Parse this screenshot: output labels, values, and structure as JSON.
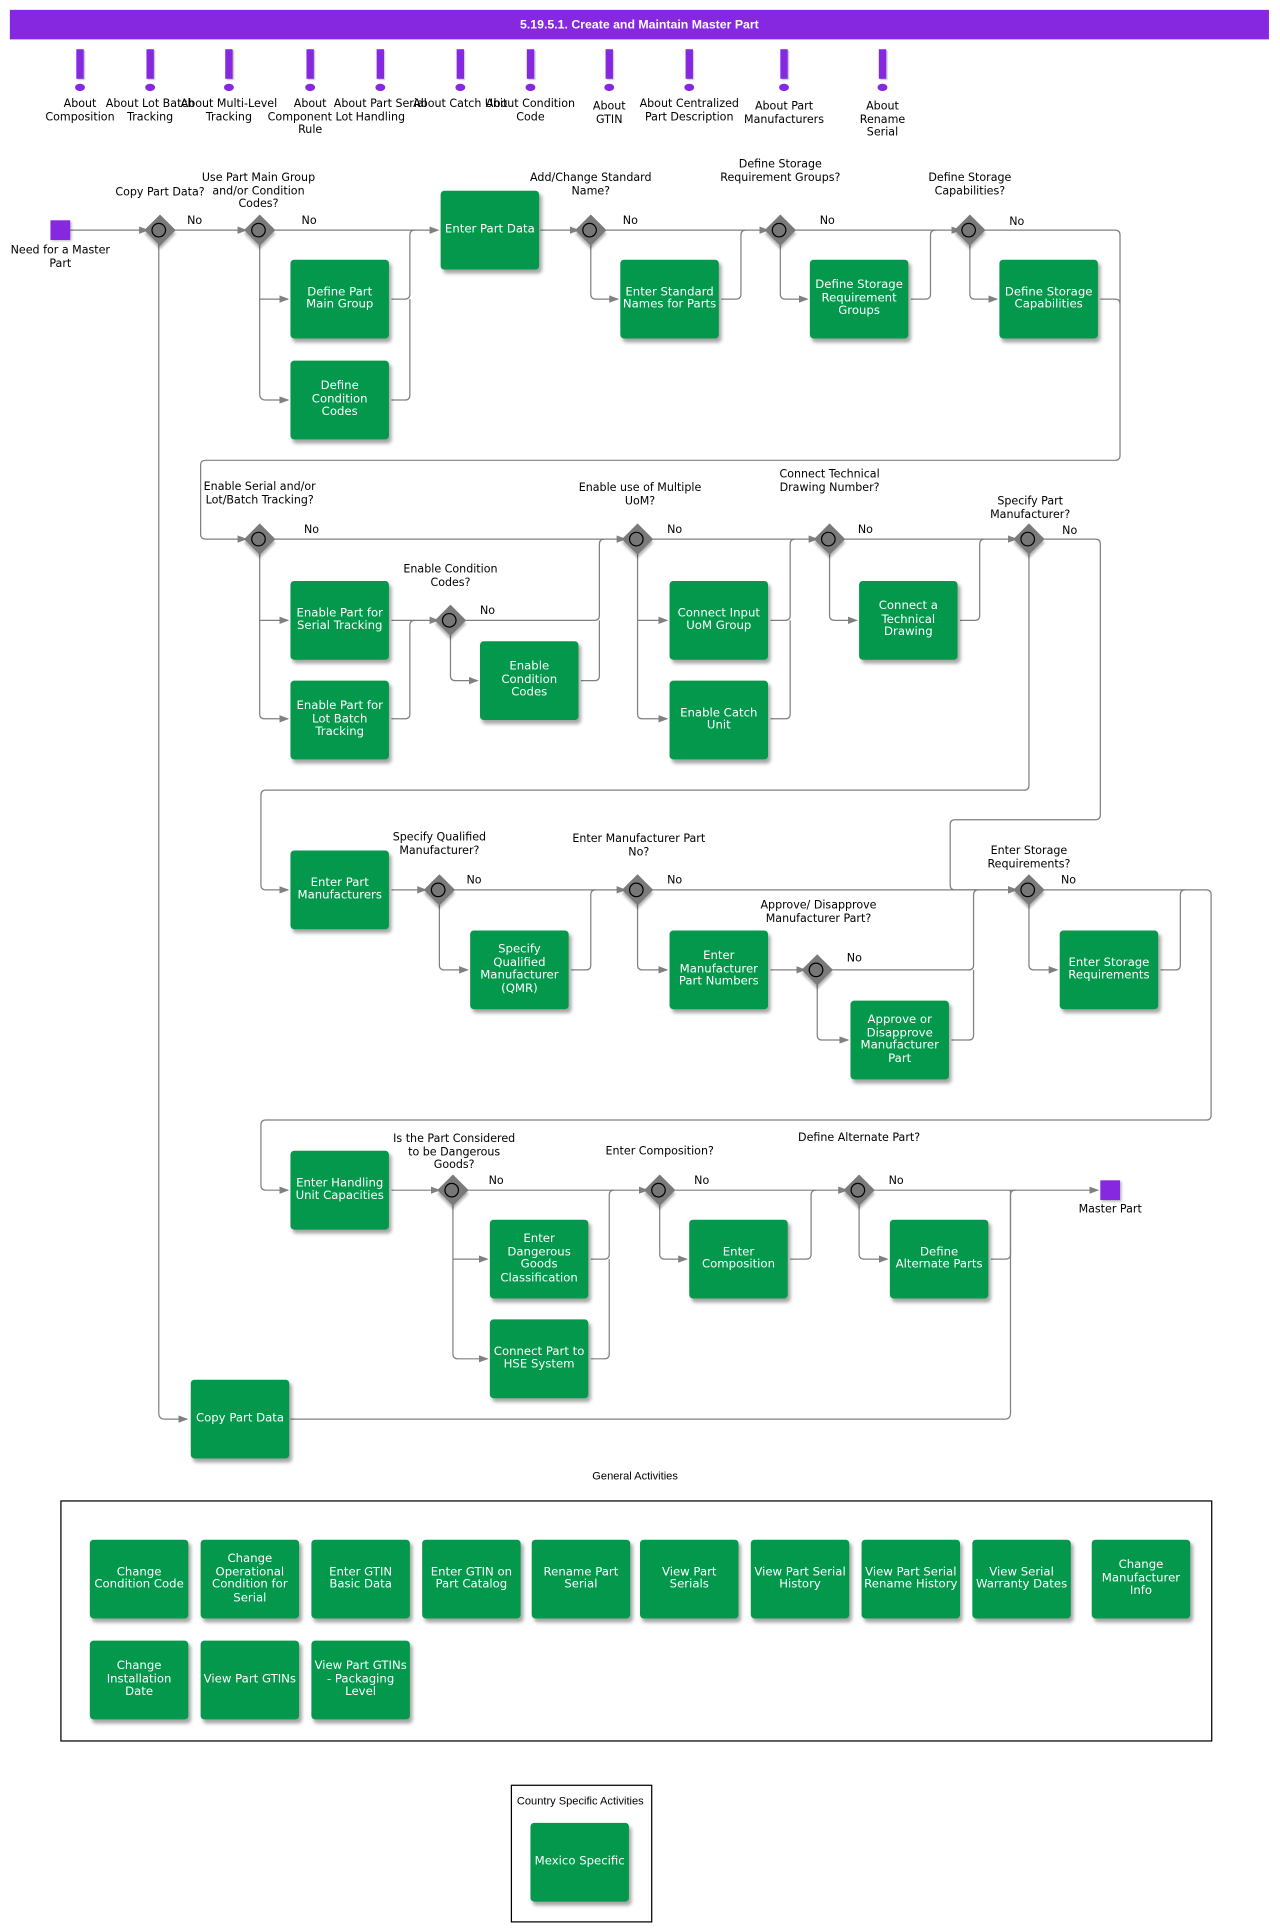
{
  "title": "5.19.5.1. Create and Maintain Master Part",
  "notes": [
    "About Composition",
    "About Lot Batch Tracking",
    "About Multi-Level Tracking",
    "About Component Lot Rule",
    "About Part Serial Handling",
    "About Catch Unit",
    "About Condition Code",
    "About GTIN",
    "About Centralized Part Description",
    "About Part Manufacturers",
    "About Rename Serial"
  ],
  "events": {
    "start": "Need for a Master Part",
    "end": "Master Part"
  },
  "no_label": "No",
  "gateways": {
    "copy_part_data": "Copy Part Data?",
    "use_main_group": "Use Part Main Group and/or Condition Codes?",
    "standard_name": "Add/Change Standard Name?",
    "storage_req_groups": "Define Storage Requirement Groups?",
    "storage_capabilities": "Define Storage Capabilities?",
    "serial_lot_tracking": "Enable Serial and/or Lot/Batch Tracking?",
    "enable_condition_codes": "Enable Condition Codes?",
    "multiple_uom": "Enable use of Multiple UoM?",
    "technical_drawing": "Connect Technical Drawing Number?",
    "specify_manufacturer": "Specify Part Manufacturer?",
    "qualified_manufacturer": "Specify Qualified Manufacturer?",
    "manufacturer_part_no": "Enter Manufacturer Part No?",
    "approve_manufacturer_part": "Approve/ Disapprove Manufacturer Part?",
    "storage_requirements": "Enter Storage Requirements?",
    "dangerous_goods": "Is the Part Considered to be Dangerous Goods?",
    "composition": "Enter Composition?",
    "alternate_part": "Define Alternate Part?"
  },
  "tasks": {
    "enter_part_data": "Enter Part Data",
    "define_main_group": "Define Part Main Group",
    "define_condition_codes": "Define Condition Codes",
    "enter_standard_names": "Enter Standard Names for Parts",
    "define_storage_req_groups": "Define Storage Requirement Groups",
    "define_storage_capabilities": "Define Storage Capabilities",
    "enable_serial_tracking": "Enable Part for Serial Tracking",
    "enable_lot_batch": "Enable Part for Lot Batch Tracking",
    "enable_condition_codes": "Enable Condition Codes",
    "connect_uom_group": "Connect Input UoM Group",
    "enable_catch_unit": "Enable Catch Unit",
    "connect_technical_drawing": "Connect a Technical Drawing",
    "enter_part_manufacturers": "Enter Part Manufacturers",
    "specify_qmr": "Specify Qualified Manufacturer (QMR)",
    "enter_manufacturer_part_numbers": "Enter Manufacturer Part Numbers",
    "approve_manufacturer_part": "Approve or Disapprove Manufacturer Part",
    "enter_storage_requirements": "Enter Storage Requirements",
    "enter_handling_unit_capacities": "Enter Handling Unit Capacities",
    "enter_dangerous_goods": "Enter Dangerous Goods Classification",
    "connect_hse": "Connect Part to HSE System",
    "enter_composition": "Enter Composition",
    "define_alternate_parts": "Define Alternate Parts",
    "copy_part_data": "Copy Part Data"
  },
  "general_activities": {
    "title": "General Activities",
    "items": [
      "Change Condition Code",
      "Change Operational Condition for Serial",
      "Enter GTIN Basic Data",
      "Enter GTIN on Part Catalog",
      "Rename Part Serial",
      "View Part Serials",
      "View Part Serial History",
      "View Part Serial Rename History",
      "View Serial Warranty Dates",
      "Change Manufacturer Info",
      "Change Installation Date",
      "View Part GTINs",
      "View Part GTINs - Packaging Level"
    ]
  },
  "country_specific": {
    "title": "Country Specific Activities",
    "items": [
      "Mexico Specific"
    ]
  },
  "colors": {
    "header": "#8528e0",
    "task": "#03984b",
    "gateway": "#7a7a7a",
    "connector": "#808080"
  }
}
